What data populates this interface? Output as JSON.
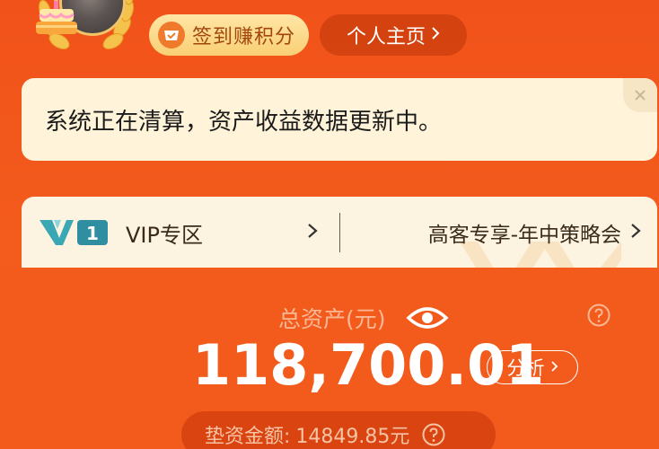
{
  "header": {
    "checkin_label": "签到赚积分",
    "profile_label": "个人主页"
  },
  "notice": {
    "text": "系统正在清算，资产收益数据更新中。"
  },
  "vip": {
    "logo_number": "1",
    "left_label": "VIP专区",
    "right_label": "高客专享-年中策略会"
  },
  "assets": {
    "title": "总资产(元)",
    "total": "118,700.01",
    "analyze_label": "分析",
    "advance_label": "垫资金额:",
    "advance_value": "14849.85元"
  },
  "colors": {
    "background": "#f35b1d",
    "notice_bg": "#fff4d9",
    "vip_bg": "#fdf3e1",
    "checkin_bg": "#f9cf74",
    "vip_logo": "#2f8fa0"
  }
}
